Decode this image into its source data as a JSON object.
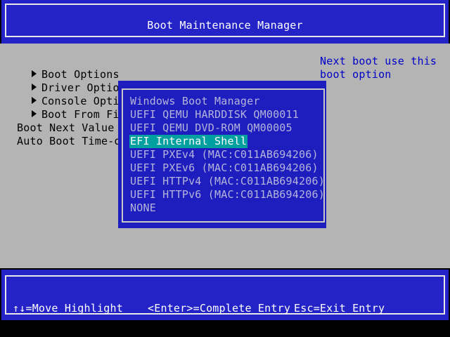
{
  "header": {
    "title": "Boot Maintenance Manager"
  },
  "menu": [
    {
      "label": "Boot Options"
    },
    {
      "label": "Driver Options"
    },
    {
      "label": "Console Options"
    },
    {
      "label": "Boot From File"
    }
  ],
  "settings": [
    {
      "label": "Boot Next Value"
    },
    {
      "label": "Auto Boot Time-out"
    }
  ],
  "help": {
    "line1": "Next boot use this",
    "line2": "boot option"
  },
  "popup": {
    "options": [
      "Windows Boot Manager",
      "UEFI QEMU HARDDISK QM00011",
      "UEFI QEMU DVD-ROM QM00005",
      "EFI Internal Shell",
      "UEFI PXEv4 (MAC:C011AB694206)",
      "UEFI PXEv6 (MAC:C011AB694206)",
      "UEFI HTTPv4 (MAC:C011AB694206)",
      "UEFI HTTPv6 (MAC:C011AB694206)",
      "NONE"
    ],
    "selected_index": 3
  },
  "footer": {
    "hint_move": "↑↓=Move Highlight",
    "hint_enter": "<Enter>=Complete Entry",
    "hint_esc": "Esc=Exit Entry"
  },
  "colors": {
    "background": "#b4b4b4",
    "bar_blue": "#2323c8",
    "popup_blue": "#1e1ebe",
    "highlight": "#00a0a0",
    "help_text": "#0000c8"
  }
}
